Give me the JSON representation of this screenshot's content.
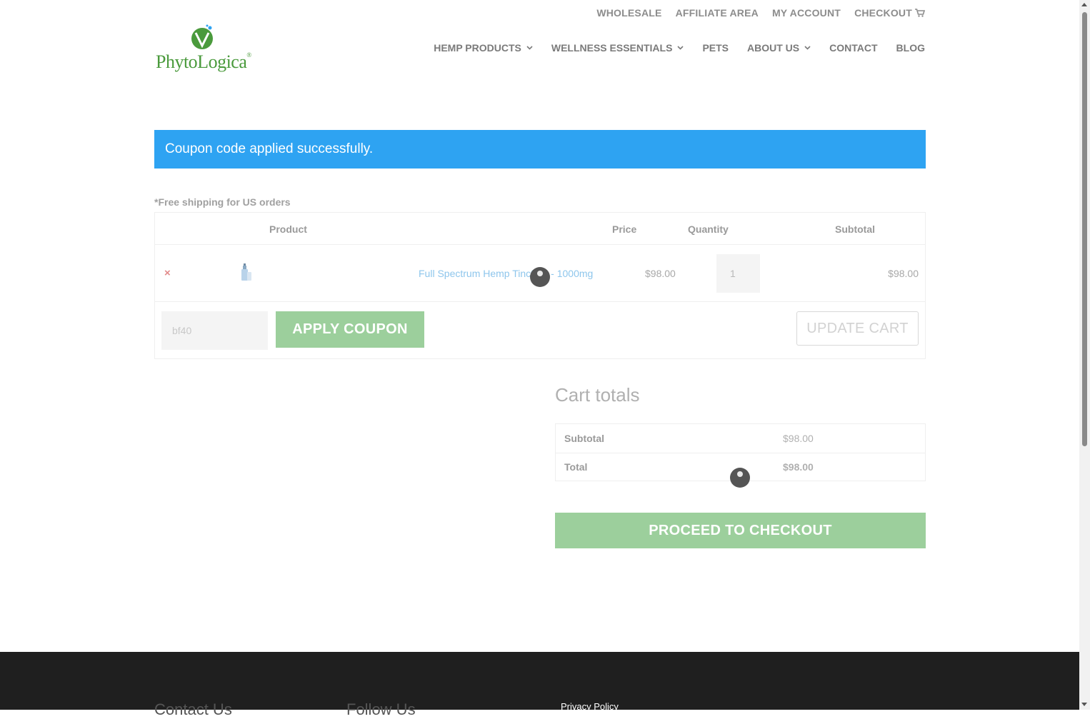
{
  "top_links": {
    "wholesale": "WHOLESALE",
    "affiliate": "AFFILIATE AREA",
    "account": "MY ACCOUNT",
    "checkout": "CHECKOUT"
  },
  "logo": {
    "text": "PhytoLogica",
    "icon": "leaf-v-logo-icon"
  },
  "nav": {
    "hemp": "HEMP PRODUCTS",
    "wellness": "WELLNESS ESSENTIALS",
    "pets": "PETS",
    "about": "ABOUT US",
    "contact": "CONTACT",
    "blog": "BLOG"
  },
  "notice": "Coupon code applied successfully.",
  "free_shipping": "*Free shipping for US orders",
  "cart": {
    "headers": {
      "product": "Product",
      "price": "Price",
      "quantity": "Quantity",
      "subtotal": "Subtotal"
    },
    "items": [
      {
        "remove": "×",
        "name": "Full Spectrum Hemp Tincture - 1000mg",
        "price": "$98.00",
        "quantity": "1",
        "subtotal": "$98.00"
      }
    ],
    "coupon_value": "bf40",
    "apply_coupon": "APPLY COUPON",
    "update_cart": "UPDATE CART"
  },
  "totals": {
    "heading": "Cart totals",
    "subtotal_label": "Subtotal",
    "subtotal_value": "$98.00",
    "total_label": "Total",
    "total_value": "$98.00",
    "checkout": "PROCEED TO CHECKOUT"
  },
  "footer": {
    "contact_heading": "Contact Us",
    "follow_heading": "Follow Us",
    "privacy": "Privacy Policy"
  },
  "colors": {
    "notice_bg": "#2ea3f2",
    "button_green": "#9ccf9c",
    "footer_bg": "#1f1f1f",
    "logo_green": "#4a9a3c"
  }
}
